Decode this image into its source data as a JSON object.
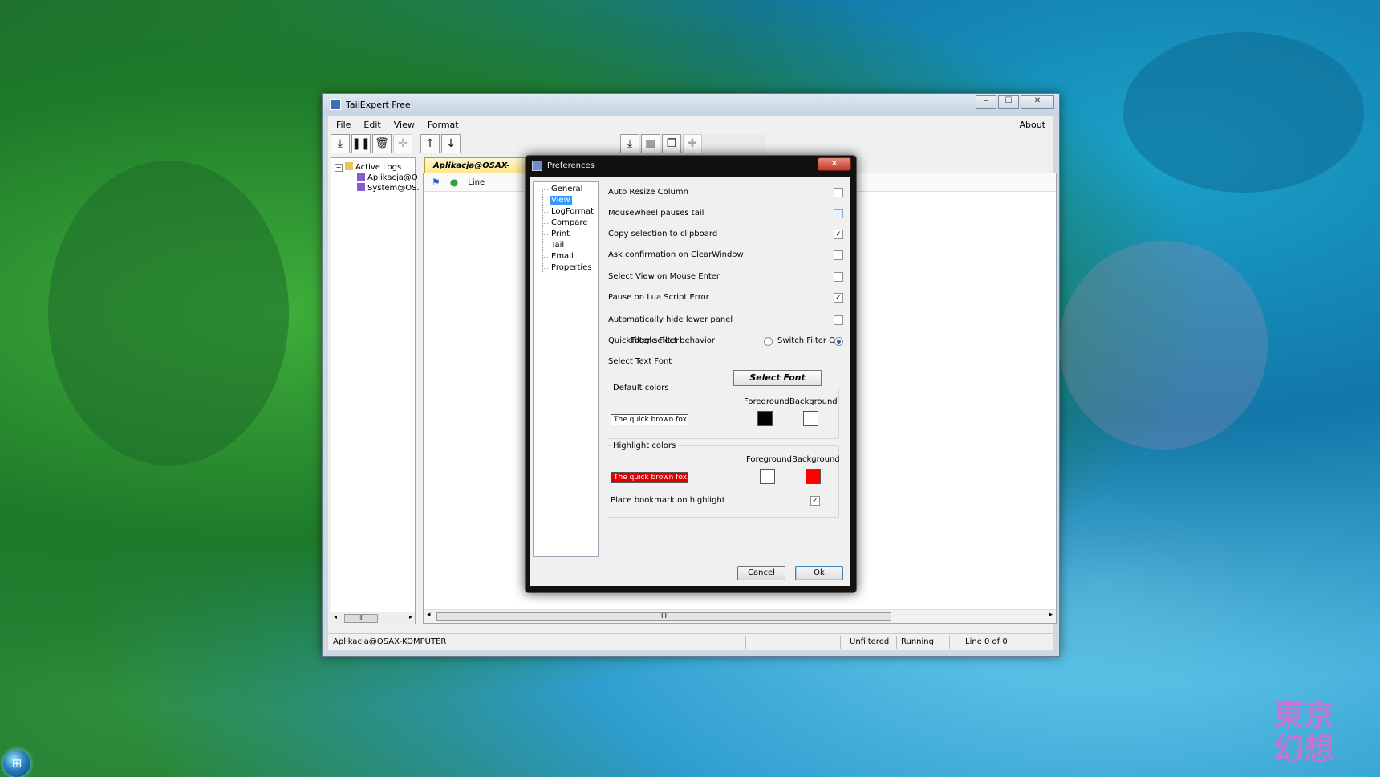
{
  "window": {
    "title": "TailExpert Free",
    "controls": {
      "minimize": "–",
      "maximize": "☐",
      "close": "✕"
    }
  },
  "menu": {
    "items": [
      "File",
      "Edit",
      "View",
      "Format"
    ],
    "about": "About"
  },
  "toolbar": {
    "left_icons": [
      "download-icon",
      "pause-icon",
      "trash-icon",
      "split-icon",
      "arrow-up-icon",
      "arrow-down-icon"
    ],
    "right_icons": [
      "import-icon",
      "columns-icon",
      "copy-icon",
      "add-icon"
    ]
  },
  "tree": {
    "root": "Active Logs",
    "children": [
      "Aplikacja@O",
      "System@OS."
    ]
  },
  "log_tab": {
    "label": "Aplikacja@OSAX-KOMP"
  },
  "log_header": {
    "column": "Line"
  },
  "statusbar": {
    "source": "Aplikacja@OSAX-KOMPUTER",
    "filter": "Unfiltered",
    "state": "Running",
    "position": "Line 0 of 0"
  },
  "preferences": {
    "title": "Preferences",
    "close": "✕",
    "nav": [
      "General",
      "View",
      "LogFormat",
      "Compare",
      "Print",
      "Tail",
      "Email",
      "Properties"
    ],
    "nav_selected": "View",
    "options": [
      {
        "label": "Auto Resize Column",
        "checked": false
      },
      {
        "label": "Mousewheel pauses tail",
        "checked": false
      },
      {
        "label": "Copy selection to clipboard",
        "checked": true
      },
      {
        "label": "Ask confirmation on ClearWindow",
        "checked": false
      },
      {
        "label": "Select View on Mouse Enter",
        "checked": false
      },
      {
        "label": "Pause on Lua Script Error",
        "checked": true
      },
      {
        "label": "Automatically hide lower panel",
        "checked": false
      }
    ],
    "quickfilter": {
      "label": "QuickFilter select behavior",
      "option_toggle": "Toggle Filter",
      "option_switch": "Switch Filter On",
      "selected": "Switch Filter On"
    },
    "font": {
      "label": "Select Text Font",
      "button": "Select Font"
    },
    "default_colors": {
      "title": "Default colors",
      "sample": "The quick brown fox...",
      "fg_label": "Foreground",
      "bg_label": "Background",
      "fg": "#000000",
      "bg": "#ffffff"
    },
    "highlight_colors": {
      "title": "Highlight colors",
      "sample": "The quick brown fox...",
      "fg_label": "Foreground",
      "bg_label": "Background",
      "fg": "#ffffff",
      "bg": "#ff0000",
      "bookmark_label": "Place bookmark on highlight",
      "bookmark_checked": true
    },
    "buttons": {
      "cancel": "Cancel",
      "ok": "Ok"
    }
  },
  "desktop": {
    "watermark": "東京幻想"
  }
}
